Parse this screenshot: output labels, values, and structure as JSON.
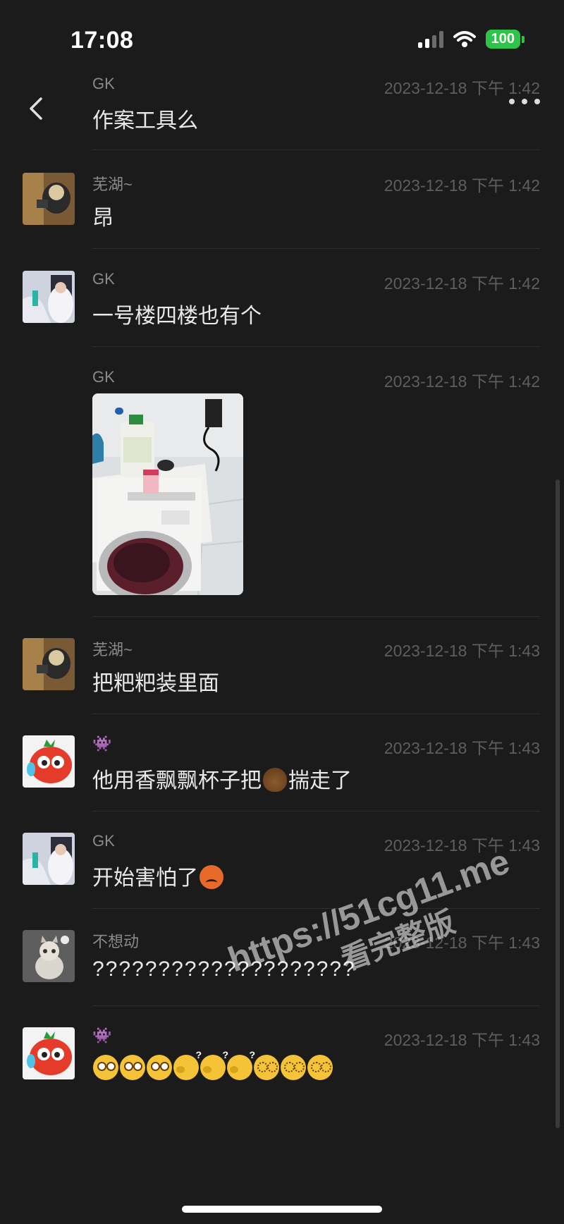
{
  "status_bar": {
    "time": "17:08",
    "battery": "100"
  },
  "header": {
    "sender": "GK",
    "timestamp": "2023-12-18 下午 1:42",
    "text": "作案工具么"
  },
  "messages": [
    {
      "name": "芜湖~",
      "timestamp": "2023-12-18 下午 1:42",
      "text": "昂"
    },
    {
      "name": "GK",
      "timestamp": "2023-12-18 下午 1:42",
      "text": "一号楼四楼也有个"
    },
    {
      "name": "GK",
      "timestamp": "2023-12-18 下午 1:42",
      "image": "photo of washing machine with bottles on top"
    },
    {
      "name": "芜湖~",
      "timestamp": "2023-12-18 下午 1:43",
      "text": "把粑粑装里面"
    },
    {
      "name": "👾",
      "timestamp": "2023-12-18 下午 1:43",
      "text_before": "他用香飘飘杯子把",
      "emoji": "poop-emoji",
      "text_after": "揣走了"
    },
    {
      "name": "GK",
      "timestamp": "2023-12-18 下午 1:43",
      "text": "开始害怕了",
      "emoji": "angry-emoji"
    },
    {
      "name": "不想动",
      "timestamp": "2023-12-18 下午 1:43",
      "text": "????????????????????"
    },
    {
      "name": "👾",
      "timestamp": "2023-12-18 下午 1:43",
      "emojis": [
        "dizzy-face",
        "dizzy-face",
        "dizzy-face",
        "sweating-question",
        "sweating-question",
        "sweating-question",
        "swirl-eyes",
        "swirl-eyes",
        "swirl-eyes"
      ]
    }
  ],
  "watermark": {
    "line1": "https://51cg11.me",
    "line2": "看完整版"
  },
  "colors": {
    "background": "#1b1b1b",
    "battery": "#2ec44a",
    "name": "#8a8a8a",
    "timestamp": "#5e5e5e"
  }
}
